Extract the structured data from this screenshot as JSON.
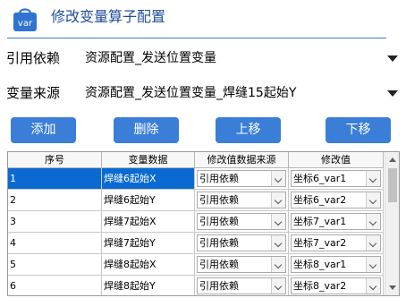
{
  "window": {
    "title": "修改变量算子配置",
    "icon_text": "var",
    "icon_color": "#2f74d0",
    "accent_line_color": "#4a78c2"
  },
  "form": {
    "dependency": {
      "label": "引用依赖",
      "value": "资源配置_发送位置变量"
    },
    "source": {
      "label": "变量来源",
      "value": "资源配置_发送位置变量_焊缝15起始Y"
    }
  },
  "toolbar": {
    "add_label": "添加",
    "delete_label": "删除",
    "up_label": "上移",
    "down_label": "下移",
    "button_color": "#3b7ed8"
  },
  "table": {
    "columns": [
      "序号",
      "变量数据",
      "修改值数据来源",
      "修改值"
    ],
    "selected_color": "#0a6ad1",
    "rows": [
      {
        "index": "1",
        "var": "焊缝6起始X",
        "source": "引用依赖",
        "value": "坐标6_var1",
        "selected": true
      },
      {
        "index": "2",
        "var": "焊缝6起始Y",
        "source": "引用依赖",
        "value": "坐标6_var2"
      },
      {
        "index": "3",
        "var": "焊缝7起始X",
        "source": "引用依赖",
        "value": "坐标7_var1"
      },
      {
        "index": "4",
        "var": "焊缝7起始Y",
        "source": "引用依赖",
        "value": "坐标7_var2"
      },
      {
        "index": "5",
        "var": "焊缝8起始X",
        "source": "引用依赖",
        "value": "坐标8_var1"
      },
      {
        "index": "6",
        "var": "焊缝8起始Y",
        "source": "引用依赖",
        "value": "坐标8_var2"
      }
    ]
  }
}
